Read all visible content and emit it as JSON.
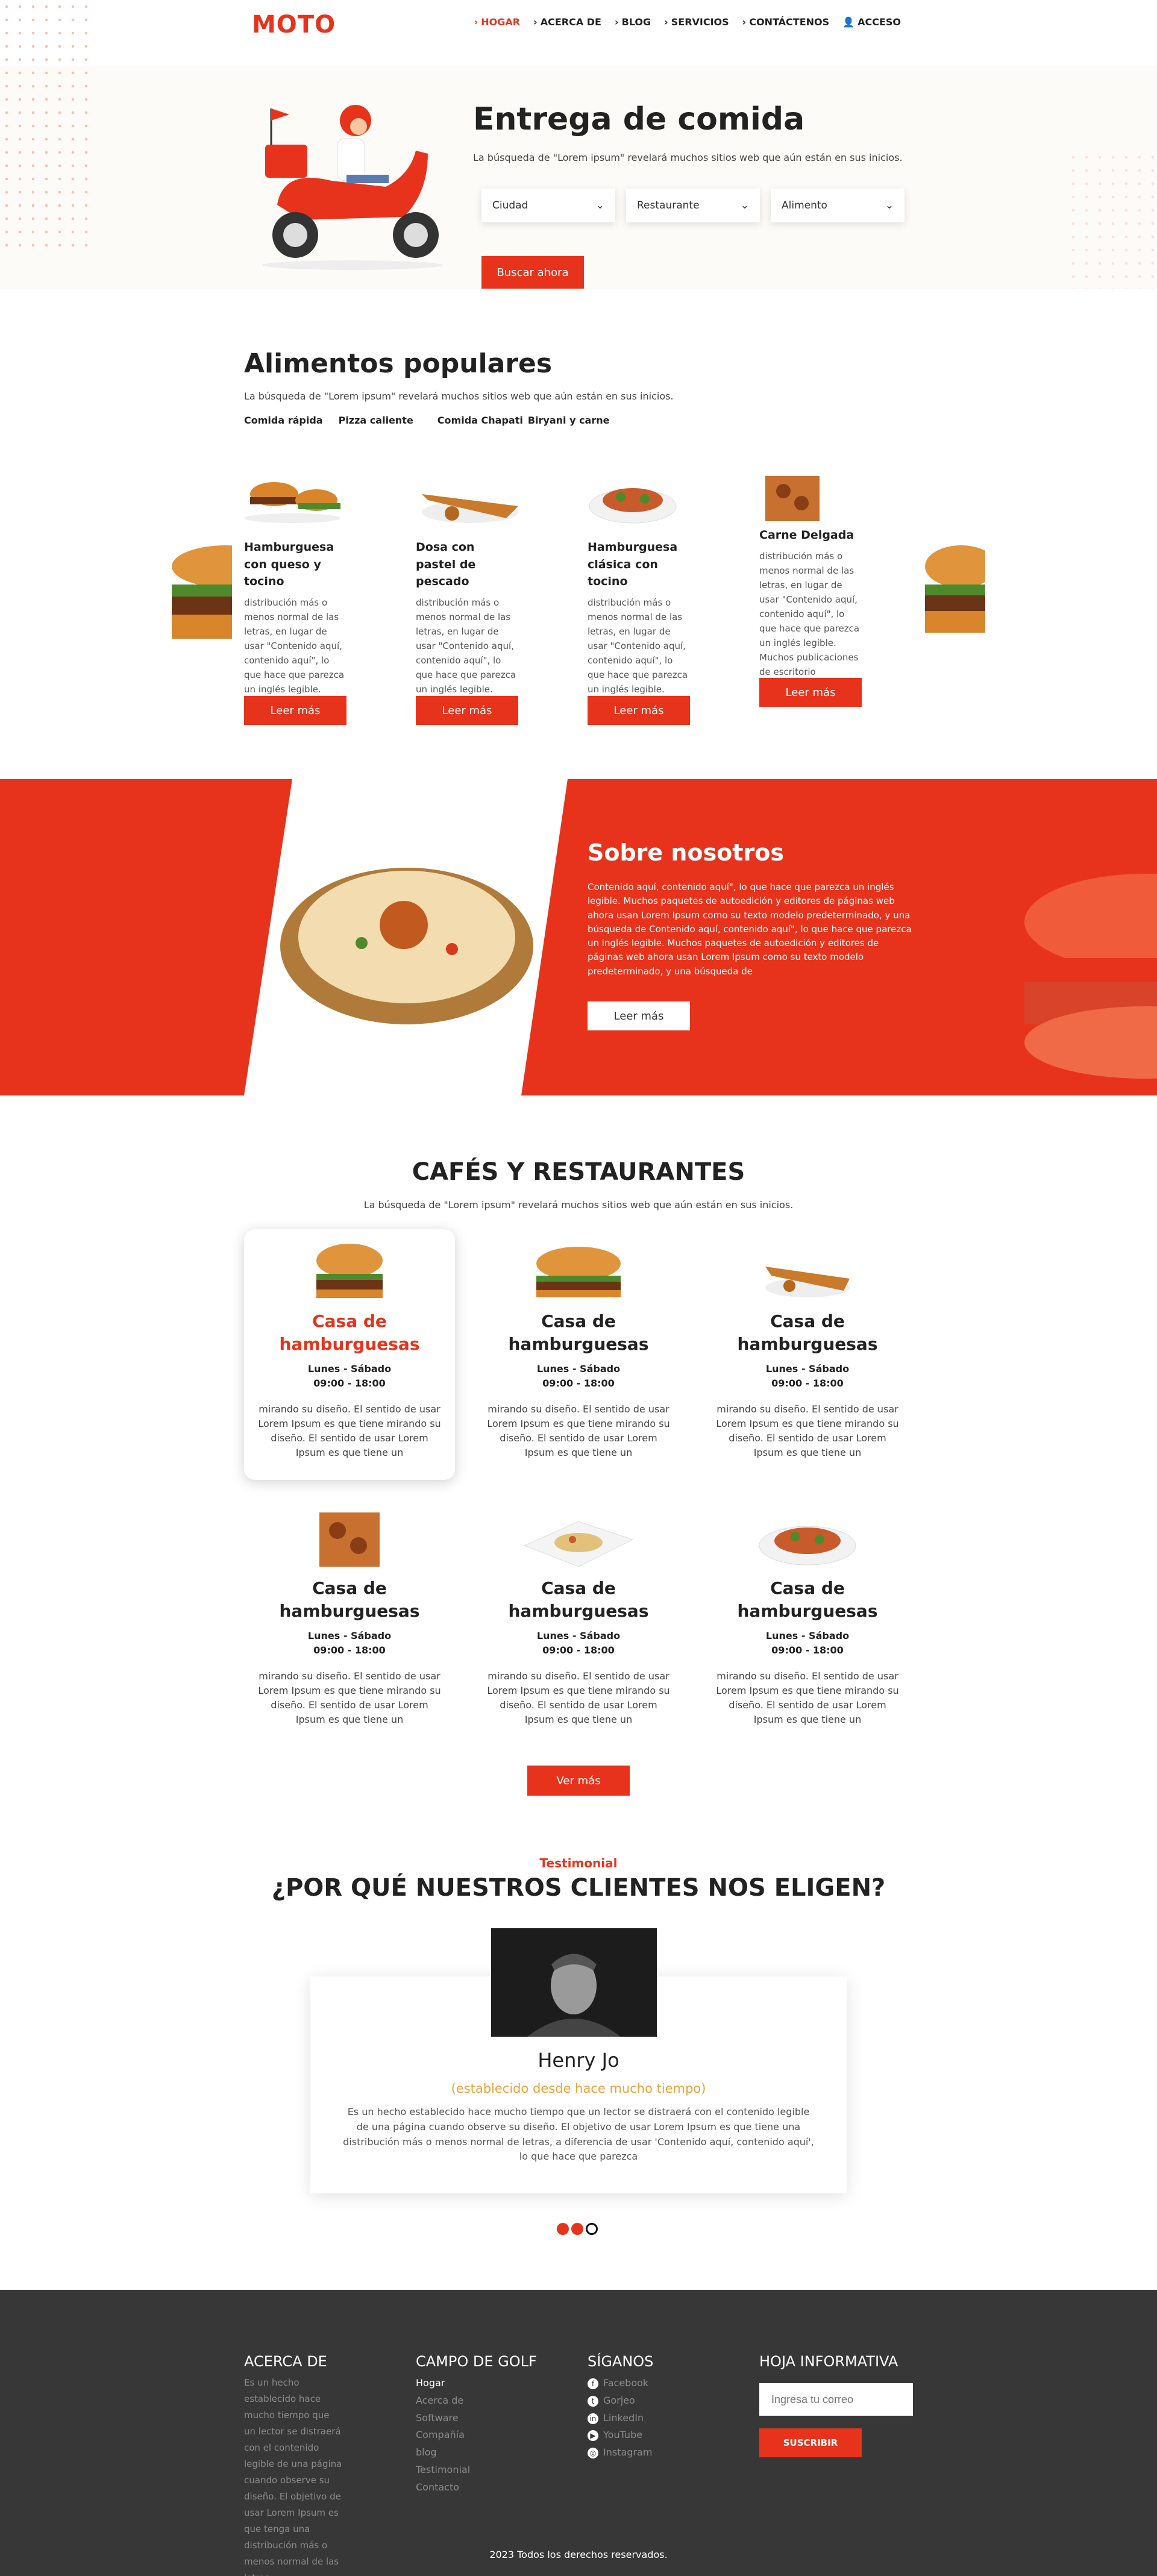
{
  "colors": {
    "accent": "#e8331c",
    "footer": "#373737"
  },
  "header": {
    "logo": "MOTO",
    "nav": [
      {
        "label": "HOGAR",
        "icon": "chevron-right-icon"
      },
      {
        "label": "ACERCA DE",
        "icon": "chevron-right-icon"
      },
      {
        "label": "BLOG",
        "icon": "chevron-right-icon"
      },
      {
        "label": "SERVICIOS",
        "icon": "chevron-right-icon"
      },
      {
        "label": "CONTÁCTENOS",
        "icon": "chevron-right-icon"
      },
      {
        "label": "ACCESO",
        "icon": "user-icon"
      }
    ]
  },
  "hero": {
    "title": "Entrega de comida",
    "subtitle": "La búsqueda de \"Lorem ipsum\" revelará muchos sitios web que aún están en sus inicios.",
    "selects": [
      "Ciudad",
      "Restaurante",
      "Alimento"
    ],
    "search_button": "Buscar ahora"
  },
  "popular": {
    "title": "Alimentos populares",
    "subtitle": "La búsqueda de \"Lorem ipsum\" revelará muchos sitios web que aún están en sus inicios.",
    "tabs": [
      "Comida rápida",
      "Pizza caliente",
      "Comida Chapati",
      "Biryani y carne"
    ],
    "items": [
      {
        "title": "Hamburguesa con queso y tocino",
        "desc": "distribución más o menos normal de las letras, en lugar de usar \"Contenido aquí, contenido aquí\", lo que hace que parezca un inglés legible. Muchos publicaciones de escritorio",
        "button": "Leer más"
      },
      {
        "title": "Dosa con pastel de pescado",
        "desc": "distribución más o menos normal de las letras, en lugar de usar \"Contenido aquí, contenido aquí\", lo que hace que parezca un inglés legible. Muchos publicaciones de escritorio",
        "button": "Leer más"
      },
      {
        "title": "Hamburguesa clásica con tocino",
        "desc": "distribución más o menos normal de las letras, en lugar de usar \"Contenido aquí, contenido aquí\", lo que hace que parezca un inglés legible. Muchos publicaciones de escritorio",
        "button": "Leer más"
      },
      {
        "title": "Carne Delgada",
        "desc": "distribución más o menos normal de las letras, en lugar de usar \"Contenido aquí, contenido aquí\", lo que hace que parezca un inglés legible. Muchos publicaciones de escritorio",
        "button": "Leer más"
      }
    ]
  },
  "about": {
    "title": "Sobre nosotros",
    "text": "Contenido aquí, contenido aquí\", lo que hace que parezca un inglés legible. Muchos paquetes de autoedición y editores de páginas web ahora usan Lorem Ipsum como su texto modelo predeterminado, y una búsqueda de Contenido aquí, contenido aquí\", lo que hace que parezca un inglés legible. Muchos paquetes de autoedición y editores de páginas web ahora usan Lorem Ipsum como su texto modelo predeterminado, y una búsqueda de",
    "button": "Leer más"
  },
  "restaurants": {
    "title": "CAFÉS Y RESTAURANTES",
    "subtitle": "La búsqueda de \"Lorem ipsum\" revelará muchos sitios web que aún están en sus inicios.",
    "items": [
      {
        "name": "Casa de hamburguesas",
        "days": "Lunes - Sábado",
        "hours": "09:00 - 18:00",
        "desc": "mirando su diseño. El sentido de usar Lorem Ipsum es que tiene mirando su diseño. El sentido de usar Lorem Ipsum es que tiene un"
      },
      {
        "name": "Casa de hamburguesas",
        "days": "Lunes - Sábado",
        "hours": "09:00 - 18:00",
        "desc": "mirando su diseño. El sentido de usar Lorem Ipsum es que tiene mirando su diseño. El sentido de usar Lorem Ipsum es que tiene un"
      },
      {
        "name": "Casa de hamburguesas",
        "days": "Lunes - Sábado",
        "hours": "09:00 - 18:00",
        "desc": "mirando su diseño. El sentido de usar Lorem Ipsum es que tiene mirando su diseño. El sentido de usar Lorem Ipsum es que tiene un"
      },
      {
        "name": "Casa de hamburguesas",
        "days": "Lunes - Sábado",
        "hours": "09:00 - 18:00",
        "desc": "mirando su diseño. El sentido de usar Lorem Ipsum es que tiene mirando su diseño. El sentido de usar Lorem Ipsum es que tiene un"
      },
      {
        "name": "Casa de hamburguesas",
        "days": "Lunes - Sábado",
        "hours": "09:00 - 18:00",
        "desc": "mirando su diseño. El sentido de usar Lorem Ipsum es que tiene mirando su diseño. El sentido de usar Lorem Ipsum es que tiene un"
      },
      {
        "name": "Casa de hamburguesas",
        "days": "Lunes - Sábado",
        "hours": "09:00 - 18:00",
        "desc": "mirando su diseño. El sentido de usar Lorem Ipsum es que tiene mirando su diseño. El sentido de usar Lorem Ipsum es que tiene un"
      }
    ],
    "more_button": "Ver más"
  },
  "testimonial": {
    "kicker": "Testimonial",
    "title": "¿POR QUÉ NUESTROS CLIENTES NOS ELIGEN?",
    "name": "Henry Jo",
    "since": "(establecido desde hace mucho tiempo)",
    "text": "Es un hecho establecido hace mucho tiempo que un lector se distraerá con el contenido legible de una página cuando observe su diseño. El objetivo de usar Lorem Ipsum es que tiene una distribución más o menos normal de letras, a diferencia de usar 'Contenido aquí, contenido aquí', lo que hace que parezca"
  },
  "footer": {
    "about": {
      "title": "ACERCA DE",
      "text": "Es un hecho establecido hace mucho tiempo que un lector se distraerá con el contenido legible de una página cuando observe su diseño. El objetivo de usar Lorem Ipsum es que tenga una distribución más o menos normal de las letras."
    },
    "links": {
      "title": "CAMPO DE GOLF",
      "items": [
        "Hogar",
        "Acerca de",
        "Software",
        "Compañía",
        "blog",
        "Testimonial",
        "Contacto"
      ]
    },
    "social": {
      "title": "SÍGANOS",
      "items": [
        {
          "label": "Facebook",
          "icon": "facebook-icon"
        },
        {
          "label": "Gorjeo",
          "icon": "twitter-icon"
        },
        {
          "label": "LinkedIn",
          "icon": "linkedin-icon"
        },
        {
          "label": "YouTube",
          "icon": "youtube-icon"
        },
        {
          "label": "Instagram",
          "icon": "instagram-icon"
        }
      ]
    },
    "newsletter": {
      "title": "HOJA INFORMATIVA",
      "placeholder": "Ingresa tu correo",
      "button": "SUSCRIBIR"
    },
    "copyright": "2023 Todos los derechos reservados."
  }
}
